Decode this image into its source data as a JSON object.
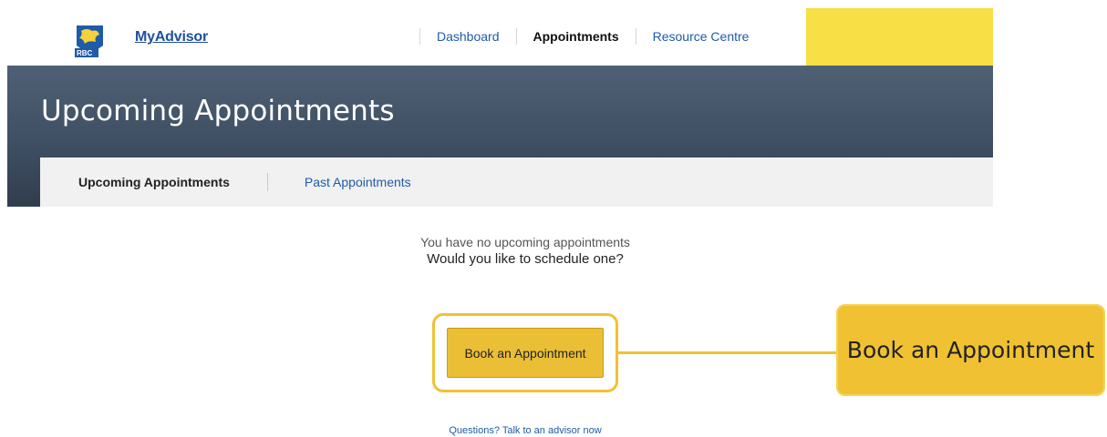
{
  "brand": {
    "logo_text": "RBC",
    "logo_icon": "rbc-lion-shield-icon",
    "app_name": "MyAdvisor"
  },
  "topnav": {
    "items": [
      {
        "label": "Dashboard",
        "active": false
      },
      {
        "label": "Appointments",
        "active": true
      },
      {
        "label": "Resource Centre",
        "active": false
      }
    ]
  },
  "hero": {
    "title": "Upcoming Appointments"
  },
  "subtabs": {
    "items": [
      {
        "label": "Upcoming Appointments",
        "active": true
      },
      {
        "label": "Past Appointments",
        "active": false
      }
    ]
  },
  "empty_state": {
    "line1": "You have no upcoming appointments",
    "line2": "Would you like to schedule one?"
  },
  "primary_action": {
    "label": "Book an Appointment"
  },
  "callout": {
    "label": "Book an Appointment"
  },
  "help": {
    "label": "Questions? Talk to an advisor now"
  },
  "colors": {
    "accent_yellow": "#f0c233",
    "button_yellow": "#eabf35",
    "link_blue": "#1f5ba8",
    "hero_dark": "#3f4f63"
  }
}
